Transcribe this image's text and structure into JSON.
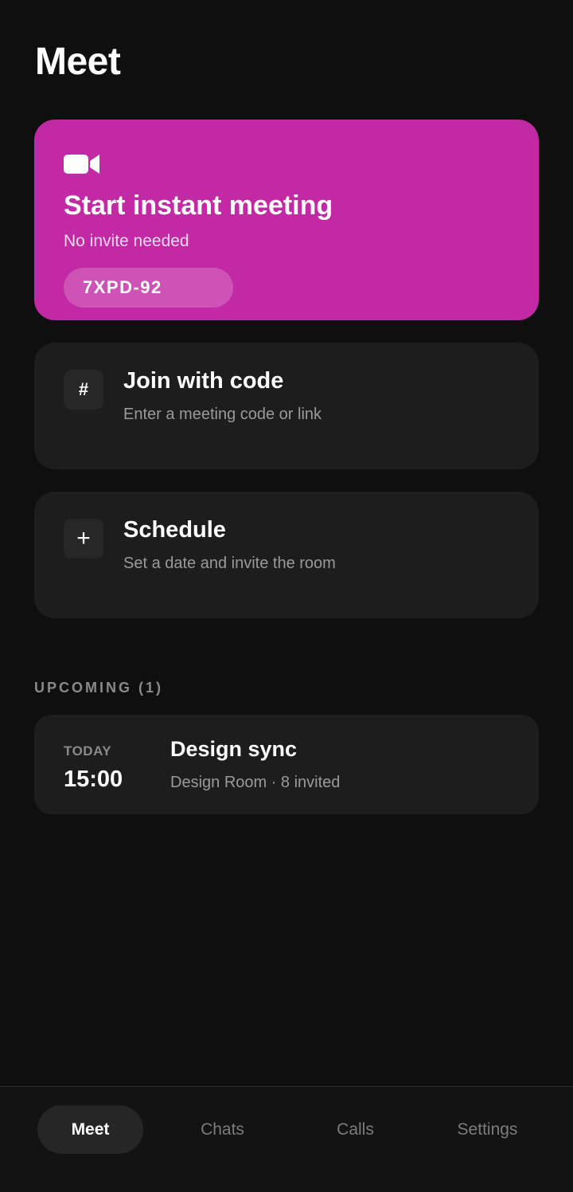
{
  "header": {
    "title": "Meet"
  },
  "instant_meeting": {
    "icon": "video-camera-icon",
    "title": "Start instant meeting",
    "subtitle": "No invite needed",
    "code": "7XPD-92",
    "accent_color": "#c229a4"
  },
  "join": {
    "icon_glyph": "#",
    "title": "Join with code",
    "subtitle": "Enter a meeting code or link"
  },
  "schedule": {
    "icon_glyph": "+",
    "title": "Schedule",
    "subtitle": "Set a date and invite the room"
  },
  "upcoming": {
    "label": "UPCOMING (1)",
    "meetings": [
      {
        "day": "TODAY",
        "time": "15:00",
        "title": "Design sync",
        "meta": "Design Room · 8 invited"
      }
    ]
  },
  "nav": {
    "active": "Meet",
    "items": [
      {
        "label": "Meet"
      },
      {
        "label": "Chats"
      },
      {
        "label": "Calls"
      },
      {
        "label": "Settings"
      }
    ]
  }
}
